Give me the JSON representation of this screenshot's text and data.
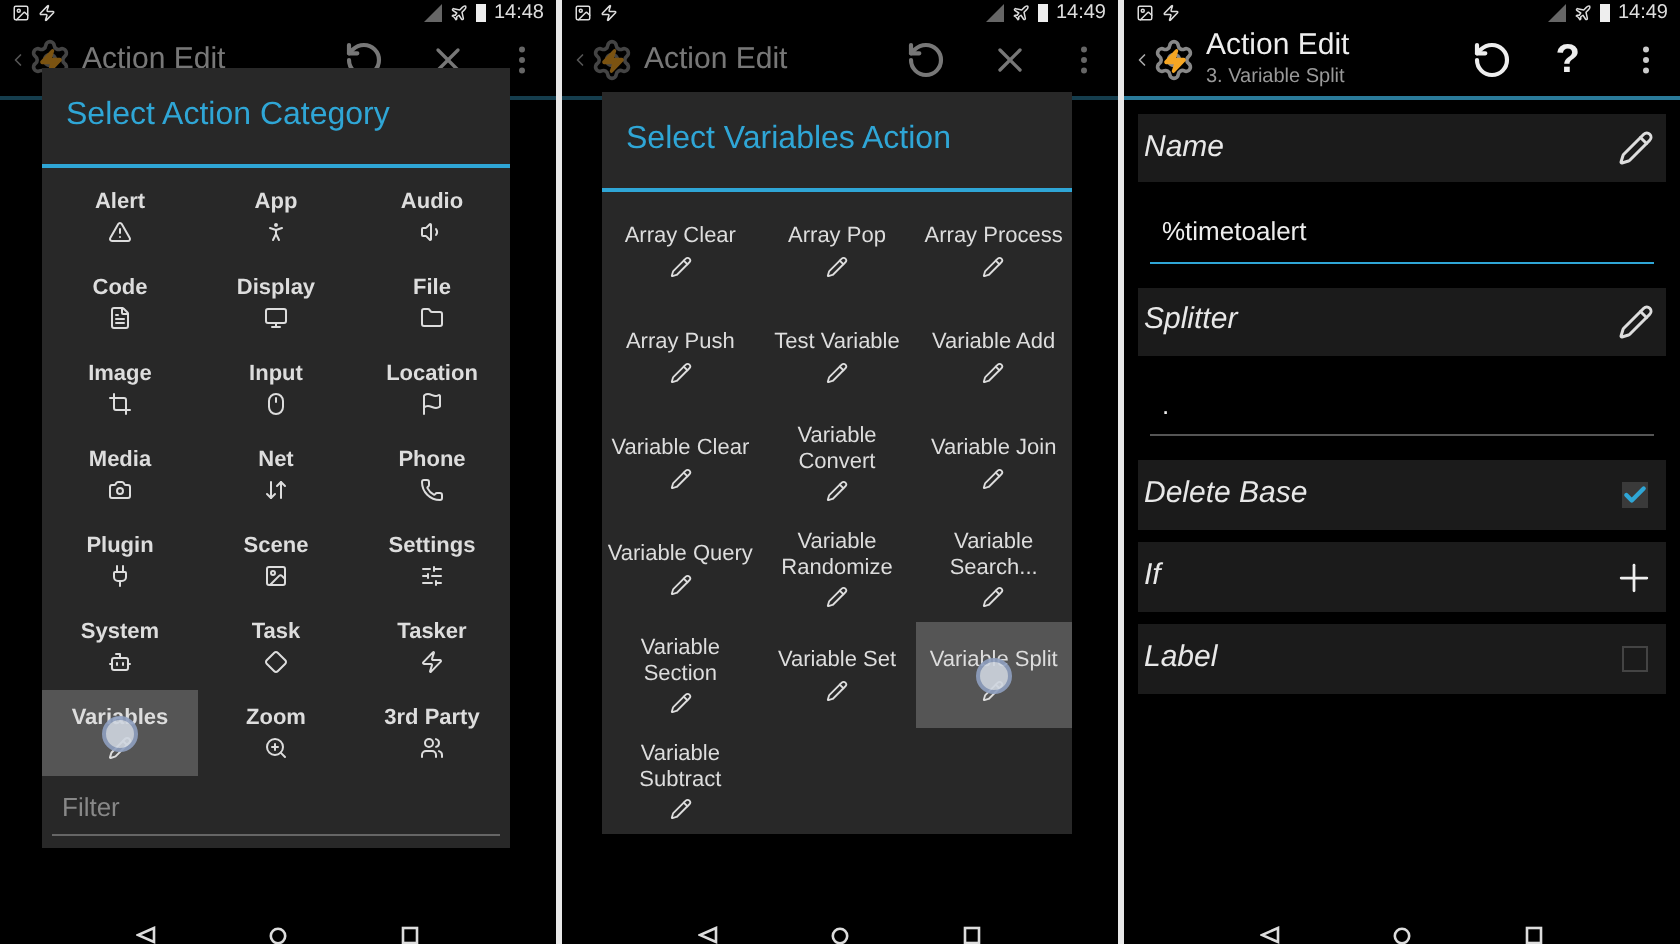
{
  "screens": [
    {
      "kind": "category_dialog",
      "status_bar": {
        "time": "14:48"
      },
      "action_bar": {
        "title": "Action Edit"
      },
      "dialog": {
        "title": "Select Action Category",
        "items": [
          {
            "label": "Alert",
            "selected": false
          },
          {
            "label": "App",
            "selected": false
          },
          {
            "label": "Audio",
            "selected": false
          },
          {
            "label": "Code",
            "selected": false
          },
          {
            "label": "Display",
            "selected": false
          },
          {
            "label": "File",
            "selected": false
          },
          {
            "label": "Image",
            "selected": false
          },
          {
            "label": "Input",
            "selected": false
          },
          {
            "label": "Location",
            "selected": false
          },
          {
            "label": "Media",
            "selected": false
          },
          {
            "label": "Net",
            "selected": false
          },
          {
            "label": "Phone",
            "selected": false
          },
          {
            "label": "Plugin",
            "selected": false
          },
          {
            "label": "Scene",
            "selected": false
          },
          {
            "label": "Settings",
            "selected": false
          },
          {
            "label": "System",
            "selected": false
          },
          {
            "label": "Task",
            "selected": false
          },
          {
            "label": "Tasker",
            "selected": false
          },
          {
            "label": "Variables",
            "selected": true
          },
          {
            "label": "Zoom",
            "selected": false
          },
          {
            "label": "3rd Party",
            "selected": false
          }
        ],
        "filter": {
          "placeholder": "Filter"
        }
      }
    },
    {
      "kind": "action_dialog",
      "status_bar": {
        "time": "14:49"
      },
      "action_bar": {
        "title": "Action Edit"
      },
      "dialog": {
        "title": "Select Variables Action",
        "items": [
          {
            "label": "Array Clear",
            "selected": false
          },
          {
            "label": "Array Pop",
            "selected": false
          },
          {
            "label": "Array Process",
            "selected": false
          },
          {
            "label": "Array Push",
            "selected": false
          },
          {
            "label": "Test Variable",
            "selected": false
          },
          {
            "label": "Variable Add",
            "selected": false
          },
          {
            "label": "Variable Clear",
            "selected": false
          },
          {
            "label": "Variable Convert",
            "selected": false
          },
          {
            "label": "Variable Join",
            "selected": false
          },
          {
            "label": "Variable Query",
            "selected": false
          },
          {
            "label": "Variable Randomize",
            "selected": false
          },
          {
            "label": "Variable Search...",
            "selected": false
          },
          {
            "label": "Variable Section",
            "selected": false
          },
          {
            "label": "Variable Set",
            "selected": false
          },
          {
            "label": "Variable Split",
            "selected": true
          },
          {
            "label": "Variable Subtract",
            "selected": false
          }
        ]
      }
    },
    {
      "kind": "action_edit",
      "status_bar": {
        "time": "14:49"
      },
      "action_bar": {
        "title": "Action Edit",
        "subtitle": "3. Variable Split",
        "help": "?"
      },
      "params": [
        {
          "kind": "edit",
          "label": "Name"
        },
        {
          "kind": "field",
          "value": "%timetoalert",
          "focused": true
        },
        {
          "kind": "edit",
          "label": "Splitter"
        },
        {
          "kind": "field",
          "value": ".",
          "focused": false
        },
        {
          "kind": "checkbox",
          "label": "Delete Base",
          "checked": true
        },
        {
          "kind": "add",
          "label": "If"
        },
        {
          "kind": "checkbox",
          "label": "Label",
          "checked": false
        }
      ]
    }
  ]
}
